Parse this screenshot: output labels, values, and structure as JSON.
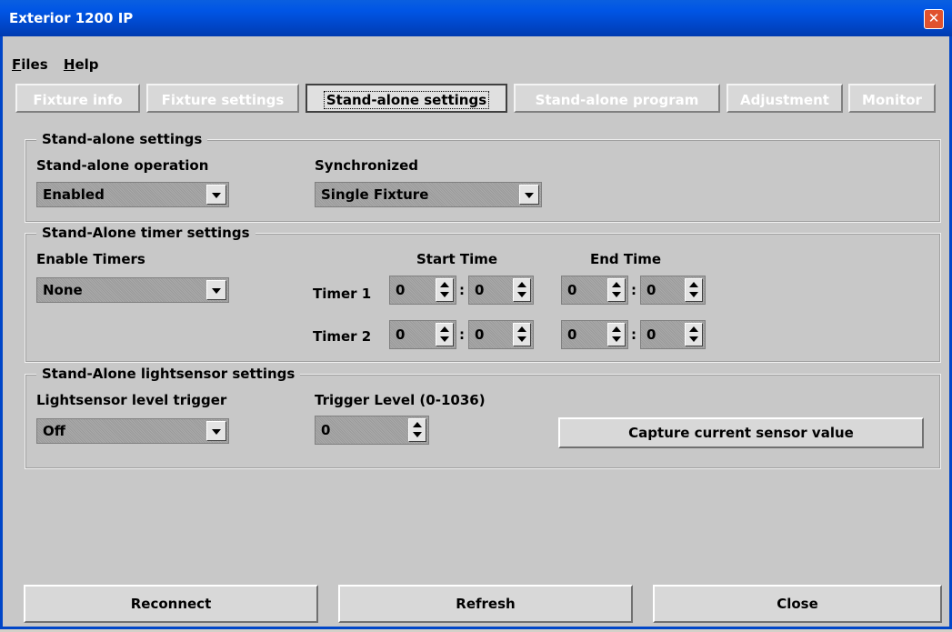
{
  "window": {
    "title": "Exterior 1200 IP",
    "close_glyph": "✕"
  },
  "menu": {
    "items": [
      {
        "label": "Files",
        "accel": "F",
        "rest": "iles"
      },
      {
        "label": "Help",
        "accel": "H",
        "rest": "elp"
      }
    ]
  },
  "tabs": [
    "Fixture info",
    "Fixture settings",
    "Stand-alone settings",
    "Stand-alone program",
    "Adjustment",
    "Monitor"
  ],
  "active_tab": "Stand-alone settings",
  "standalone": {
    "legend": "Stand-alone settings",
    "operation_label": "Stand-alone operation",
    "operation_value": "Enabled",
    "sync_label": "Synchronized",
    "sync_value": "Single Fixture"
  },
  "timers": {
    "legend": "Stand-Alone timer settings",
    "enable_label": "Enable Timers",
    "enable_value": "None",
    "start_label": "Start Time",
    "end_label": "End Time",
    "timer1": {
      "label": "Timer 1",
      "start_h": "0",
      "start_m": "0",
      "end_h": "0",
      "end_m": "0"
    },
    "timer2": {
      "label": "Timer 2",
      "start_h": "0",
      "start_m": "0",
      "end_h": "0",
      "end_m": "0"
    },
    "colon": ":"
  },
  "lightsensor": {
    "legend": "Stand-Alone lightsensor settings",
    "trigger_label": "Lightsensor level trigger",
    "trigger_value": "Off",
    "level_label": "Trigger Level (0-1036)",
    "level_value": "0",
    "capture_label": "Capture current sensor value"
  },
  "footer": {
    "reconnect": "Reconnect",
    "refresh": "Refresh",
    "close": "Close"
  }
}
